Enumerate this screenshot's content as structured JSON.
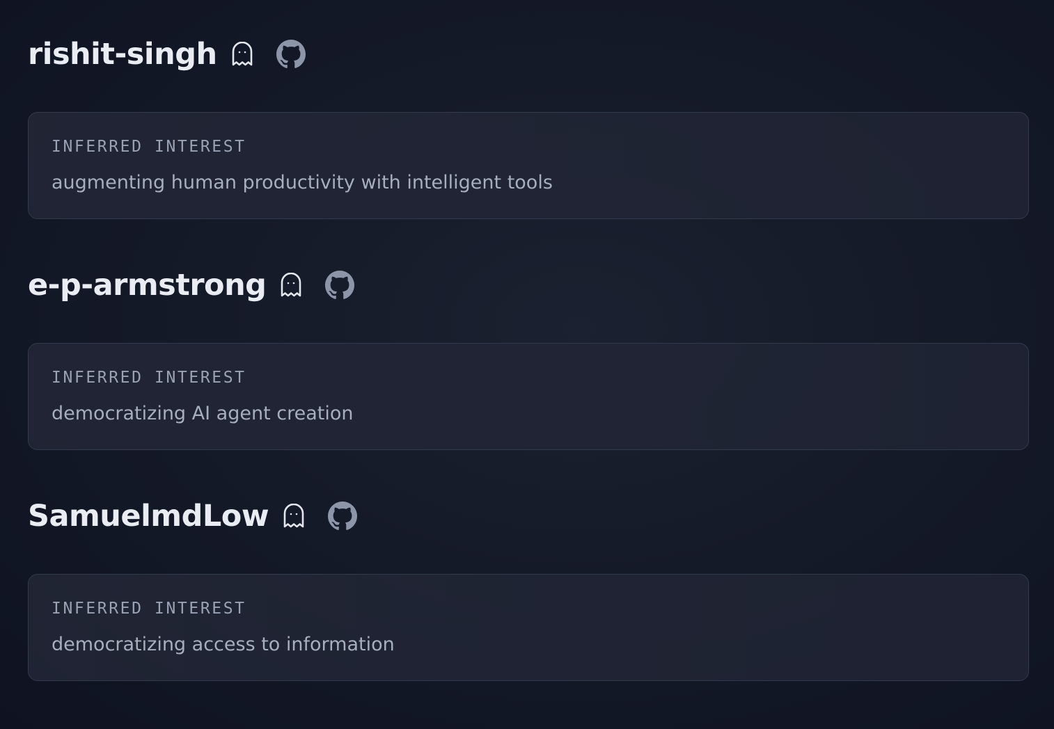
{
  "profiles": [
    {
      "username": "rishit-singh",
      "interest_label": "INFERRED INTEREST",
      "interest": "augmenting human productivity with intelligent tools",
      "icons": [
        "ghost-icon",
        "github-icon"
      ]
    },
    {
      "username": "e-p-armstrong",
      "interest_label": "INFERRED INTEREST",
      "interest": "democratizing AI agent creation",
      "icons": [
        "ghost-icon",
        "github-icon"
      ]
    },
    {
      "username": "SamuelmdLow",
      "interest_label": "INFERRED INTEREST",
      "interest": "democratizing access to information",
      "icons": [
        "ghost-icon",
        "github-icon"
      ]
    }
  ],
  "colors": {
    "background": "#141927",
    "username": "#e9ecf2",
    "card_border": "#333a4b",
    "label": "#9aa2b3",
    "text": "#a7aebd",
    "icon": "#e3e6ec",
    "github_icon": "#8d96a8"
  }
}
